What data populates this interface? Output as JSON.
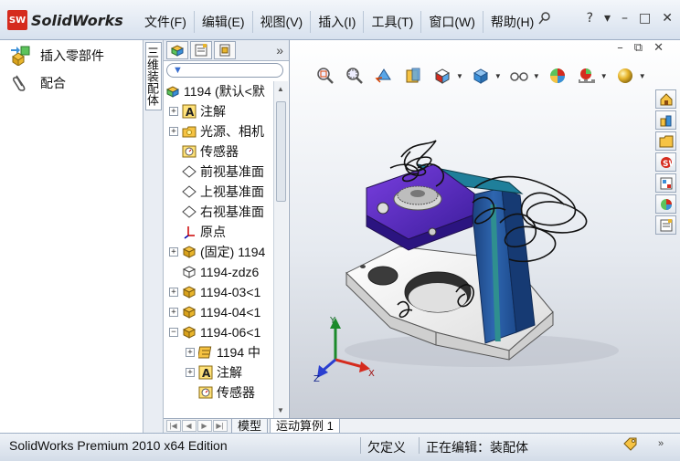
{
  "app": {
    "logo_badge": "SW",
    "logo_text": "SolidWorks",
    "brand_color": "#d52b1e"
  },
  "menu": [
    "文件(F)",
    "编辑(E)",
    "视图(V)",
    "插入(I)",
    "工具(T)",
    "窗口(W)",
    "帮助(H)"
  ],
  "window_controls": {
    "help": "?",
    "dropdown": "▾",
    "minimize": "–",
    "maximize": "□",
    "close": "✕"
  },
  "viewport_controls": {
    "minimize": "–",
    "restore": "⧉",
    "close": "✕"
  },
  "left_pane": {
    "commands": [
      {
        "label": "插入零部件",
        "icon": "insert-component-icon"
      },
      {
        "label": "配合",
        "icon": "mate-icon"
      }
    ]
  },
  "vertical_tab": "三维装配体",
  "tree_panel": {
    "more": "»",
    "filter_icon": "▼",
    "nodes": [
      {
        "label": "1194  (默认<默",
        "icon": "assembly-icon",
        "level": 0,
        "expander": ""
      },
      {
        "label": "注解",
        "icon": "annotation-icon",
        "level": 1,
        "expander": "+"
      },
      {
        "label": "光源、相机",
        "icon": "lights-icon",
        "level": 1,
        "expander": "+"
      },
      {
        "label": "传感器",
        "icon": "sensor-icon",
        "level": 1,
        "expander": ""
      },
      {
        "label": "前视基准面",
        "icon": "plane-icon",
        "level": 1,
        "expander": ""
      },
      {
        "label": "上视基准面",
        "icon": "plane-icon",
        "level": 1,
        "expander": ""
      },
      {
        "label": "右视基准面",
        "icon": "plane-icon",
        "level": 1,
        "expander": ""
      },
      {
        "label": "原点",
        "icon": "origin-icon",
        "level": 1,
        "expander": ""
      },
      {
        "label": "(固定) 1194",
        "icon": "part-icon",
        "level": 1,
        "expander": "+"
      },
      {
        "label": "1194-zdz6",
        "icon": "part-outline-icon",
        "level": 1,
        "expander": ""
      },
      {
        "label": "1194-03<1",
        "icon": "part-icon",
        "level": 1,
        "expander": "+"
      },
      {
        "label": "1194-04<1",
        "icon": "part-icon",
        "level": 1,
        "expander": "+"
      },
      {
        "label": "1194-06<1",
        "icon": "part-icon",
        "level": 1,
        "expander": "−"
      },
      {
        "label": "1194 中",
        "icon": "subpart-icon",
        "level": 2,
        "expander": "+"
      },
      {
        "label": "注解",
        "icon": "annotation-icon",
        "level": 2,
        "expander": "+"
      },
      {
        "label": "传感器",
        "icon": "sensor-icon",
        "level": 2,
        "expander": ""
      }
    ]
  },
  "hud_icons": [
    "zoom-fit-icon",
    "zoom-area-icon",
    "previous-view-icon",
    "section-view-icon",
    "view-orientation-icon",
    "display-style-icon",
    "hide-show-icon",
    "appearance-icon",
    "scene-icon",
    "realview-icon"
  ],
  "task_pane_icons": [
    "home-icon",
    "design-library-icon",
    "file-explorer-icon",
    "search-icon",
    "view-palette-icon",
    "appearances-icon",
    "custom-properties-icon"
  ],
  "axes": {
    "x": "X",
    "y": "Y",
    "z": "Z"
  },
  "bottom_tabs": [
    "模型",
    "运动算例 1"
  ],
  "status": {
    "edition": "SolidWorks Premium 2010 x64 Edition",
    "definition": "欠定义",
    "editing": "正在编辑：装配体",
    "chevron": "»"
  }
}
